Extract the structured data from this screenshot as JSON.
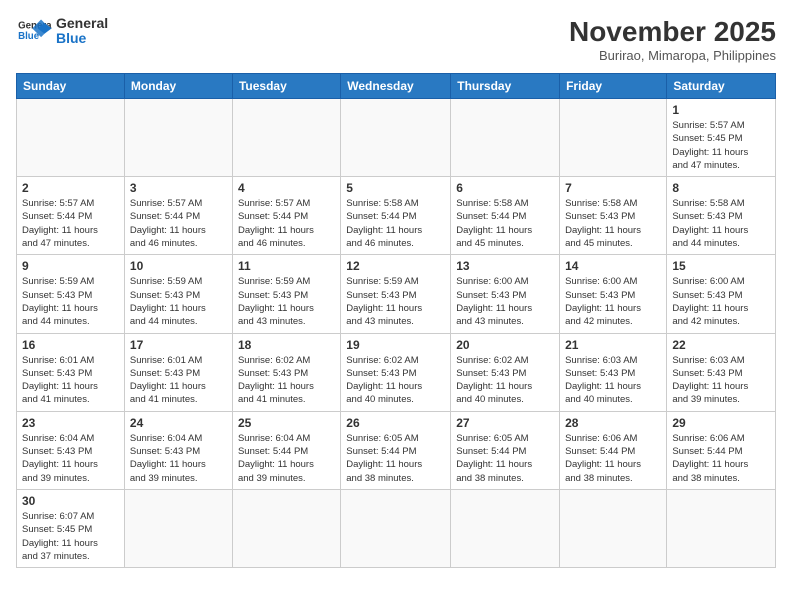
{
  "header": {
    "logo_general": "General",
    "logo_blue": "Blue",
    "month_title": "November 2025",
    "location": "Burirao, Mimaropa, Philippines"
  },
  "days_of_week": [
    "Sunday",
    "Monday",
    "Tuesday",
    "Wednesday",
    "Thursday",
    "Friday",
    "Saturday"
  ],
  "weeks": [
    [
      {
        "num": "",
        "info": ""
      },
      {
        "num": "",
        "info": ""
      },
      {
        "num": "",
        "info": ""
      },
      {
        "num": "",
        "info": ""
      },
      {
        "num": "",
        "info": ""
      },
      {
        "num": "",
        "info": ""
      },
      {
        "num": "1",
        "info": "Sunrise: 5:57 AM\nSunset: 5:45 PM\nDaylight: 11 hours\nand 47 minutes."
      }
    ],
    [
      {
        "num": "2",
        "info": "Sunrise: 5:57 AM\nSunset: 5:44 PM\nDaylight: 11 hours\nand 47 minutes."
      },
      {
        "num": "3",
        "info": "Sunrise: 5:57 AM\nSunset: 5:44 PM\nDaylight: 11 hours\nand 46 minutes."
      },
      {
        "num": "4",
        "info": "Sunrise: 5:57 AM\nSunset: 5:44 PM\nDaylight: 11 hours\nand 46 minutes."
      },
      {
        "num": "5",
        "info": "Sunrise: 5:58 AM\nSunset: 5:44 PM\nDaylight: 11 hours\nand 46 minutes."
      },
      {
        "num": "6",
        "info": "Sunrise: 5:58 AM\nSunset: 5:44 PM\nDaylight: 11 hours\nand 45 minutes."
      },
      {
        "num": "7",
        "info": "Sunrise: 5:58 AM\nSunset: 5:43 PM\nDaylight: 11 hours\nand 45 minutes."
      },
      {
        "num": "8",
        "info": "Sunrise: 5:58 AM\nSunset: 5:43 PM\nDaylight: 11 hours\nand 44 minutes."
      }
    ],
    [
      {
        "num": "9",
        "info": "Sunrise: 5:59 AM\nSunset: 5:43 PM\nDaylight: 11 hours\nand 44 minutes."
      },
      {
        "num": "10",
        "info": "Sunrise: 5:59 AM\nSunset: 5:43 PM\nDaylight: 11 hours\nand 44 minutes."
      },
      {
        "num": "11",
        "info": "Sunrise: 5:59 AM\nSunset: 5:43 PM\nDaylight: 11 hours\nand 43 minutes."
      },
      {
        "num": "12",
        "info": "Sunrise: 5:59 AM\nSunset: 5:43 PM\nDaylight: 11 hours\nand 43 minutes."
      },
      {
        "num": "13",
        "info": "Sunrise: 6:00 AM\nSunset: 5:43 PM\nDaylight: 11 hours\nand 43 minutes."
      },
      {
        "num": "14",
        "info": "Sunrise: 6:00 AM\nSunset: 5:43 PM\nDaylight: 11 hours\nand 42 minutes."
      },
      {
        "num": "15",
        "info": "Sunrise: 6:00 AM\nSunset: 5:43 PM\nDaylight: 11 hours\nand 42 minutes."
      }
    ],
    [
      {
        "num": "16",
        "info": "Sunrise: 6:01 AM\nSunset: 5:43 PM\nDaylight: 11 hours\nand 41 minutes."
      },
      {
        "num": "17",
        "info": "Sunrise: 6:01 AM\nSunset: 5:43 PM\nDaylight: 11 hours\nand 41 minutes."
      },
      {
        "num": "18",
        "info": "Sunrise: 6:02 AM\nSunset: 5:43 PM\nDaylight: 11 hours\nand 41 minutes."
      },
      {
        "num": "19",
        "info": "Sunrise: 6:02 AM\nSunset: 5:43 PM\nDaylight: 11 hours\nand 40 minutes."
      },
      {
        "num": "20",
        "info": "Sunrise: 6:02 AM\nSunset: 5:43 PM\nDaylight: 11 hours\nand 40 minutes."
      },
      {
        "num": "21",
        "info": "Sunrise: 6:03 AM\nSunset: 5:43 PM\nDaylight: 11 hours\nand 40 minutes."
      },
      {
        "num": "22",
        "info": "Sunrise: 6:03 AM\nSunset: 5:43 PM\nDaylight: 11 hours\nand 39 minutes."
      }
    ],
    [
      {
        "num": "23",
        "info": "Sunrise: 6:04 AM\nSunset: 5:43 PM\nDaylight: 11 hours\nand 39 minutes."
      },
      {
        "num": "24",
        "info": "Sunrise: 6:04 AM\nSunset: 5:43 PM\nDaylight: 11 hours\nand 39 minutes."
      },
      {
        "num": "25",
        "info": "Sunrise: 6:04 AM\nSunset: 5:44 PM\nDaylight: 11 hours\nand 39 minutes."
      },
      {
        "num": "26",
        "info": "Sunrise: 6:05 AM\nSunset: 5:44 PM\nDaylight: 11 hours\nand 38 minutes."
      },
      {
        "num": "27",
        "info": "Sunrise: 6:05 AM\nSunset: 5:44 PM\nDaylight: 11 hours\nand 38 minutes."
      },
      {
        "num": "28",
        "info": "Sunrise: 6:06 AM\nSunset: 5:44 PM\nDaylight: 11 hours\nand 38 minutes."
      },
      {
        "num": "29",
        "info": "Sunrise: 6:06 AM\nSunset: 5:44 PM\nDaylight: 11 hours\nand 38 minutes."
      }
    ],
    [
      {
        "num": "30",
        "info": "Sunrise: 6:07 AM\nSunset: 5:45 PM\nDaylight: 11 hours\nand 37 minutes."
      },
      {
        "num": "",
        "info": ""
      },
      {
        "num": "",
        "info": ""
      },
      {
        "num": "",
        "info": ""
      },
      {
        "num": "",
        "info": ""
      },
      {
        "num": "",
        "info": ""
      },
      {
        "num": "",
        "info": ""
      }
    ]
  ]
}
